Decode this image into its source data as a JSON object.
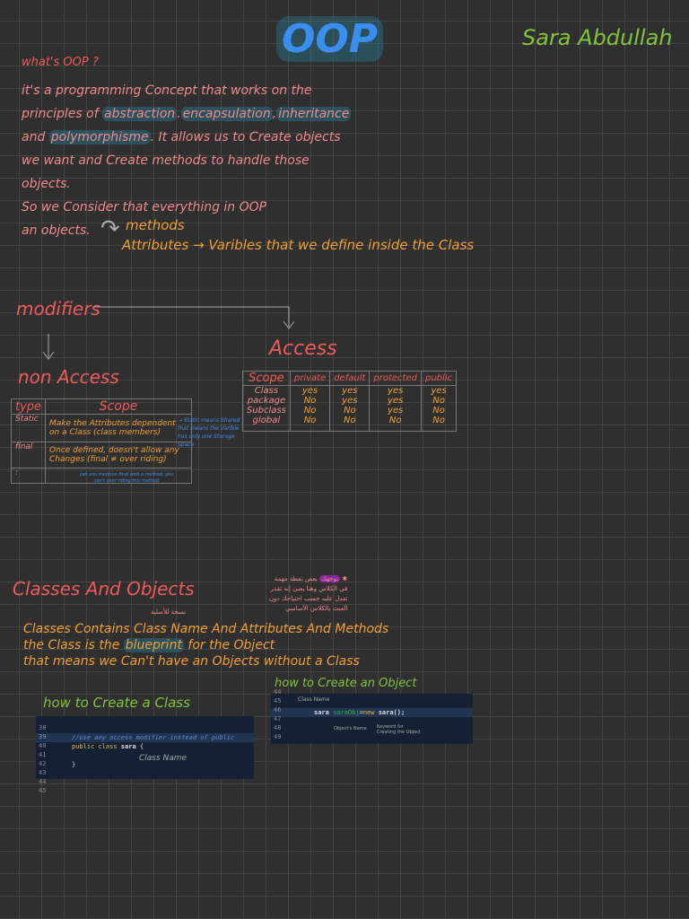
{
  "title": "OOP",
  "author": "Sara Abdullah",
  "intro": {
    "question": "what's OOP ?",
    "lines": [
      "it's a programming Concept that works on the",
      "principles of",
      "and",
      "we want and Create methods to handle those",
      "objects.",
      "So we Consider that everything in OOP",
      "an objects."
    ],
    "highlights": [
      "abstraction",
      "encapsulation",
      "inheritance",
      "polymorphisme"
    ],
    "line3_rest": ". It allows us to Create objects",
    "methods": "methods",
    "attributes": "Attributes → Varibles that we define inside the Class"
  },
  "modifiers": {
    "heading": "modifiers",
    "non_access": "non Access",
    "access": "Access",
    "non_access_table": {
      "headers": [
        "type",
        "Scope"
      ],
      "rows": [
        {
          "type": "Static",
          "scope": "Make the Attributes dependent on a Class (class members)"
        },
        {
          "type": "final",
          "scope": "Once defined, doesn't allow any Changes (final ≠ over riding)"
        },
        {
          "type": ":",
          "scope": ""
        }
      ],
      "note_static": "→ Static means Shared that means the Varible has only one Storage Space",
      "note_final": "can you mention final with a method, you can't over riding this method"
    },
    "access_table": {
      "headers": [
        "Scope",
        "private",
        "default",
        "protected",
        "public"
      ],
      "rows": [
        [
          "Class",
          "yes",
          "yes",
          "yes",
          "yes"
        ],
        [
          "package",
          "No",
          "yes",
          "yes",
          "No"
        ],
        [
          "Subclass",
          "No",
          "No",
          "yes",
          "No"
        ],
        [
          "global",
          "No",
          "No",
          "No",
          "No"
        ]
      ]
    }
  },
  "classes": {
    "heading": "Classes And Objects",
    "arabic_note_hl": "بوجهك",
    "arabic_note": [
      "بعض نقطة مهمة",
      "في الكلاس وهنا يعني إنه تقدر",
      "تعدل عليه حسب احتياجك دون",
      "العبث بالكلاس الأساسي"
    ],
    "arabic_small": "نسخة للأصلية",
    "lines": [
      "Classes Contains Class Name And Attributes And Methods",
      "the Class is the",
      "that means we Can't have an Objects without a Class"
    ],
    "blueprint": "blueprint",
    "line2_rest": " for the Object",
    "create_class": {
      "heading": "how to Create a Class",
      "line_numbers": [
        "38",
        "39",
        "40",
        "41",
        "42",
        "43",
        "44",
        "45"
      ],
      "comment": "//use any access modifier instead of public",
      "code_kw": "public class",
      "code_name": "sara",
      "code_brace": "{",
      "close_brace": "}",
      "annotation": "Class Name"
    },
    "create_object": {
      "heading": "how to Create an Object",
      "line_numbers": [
        "44",
        "45",
        "46",
        "47",
        "48",
        "49"
      ],
      "code_type": "sara",
      "code_var": "saraObj",
      "code_eq": "=",
      "code_new": "new",
      "code_ctor": "sara();",
      "ann_class": "Class Name",
      "ann_obj": "Object's Name",
      "ann_kw": "Keyword for Creating the Object"
    }
  }
}
